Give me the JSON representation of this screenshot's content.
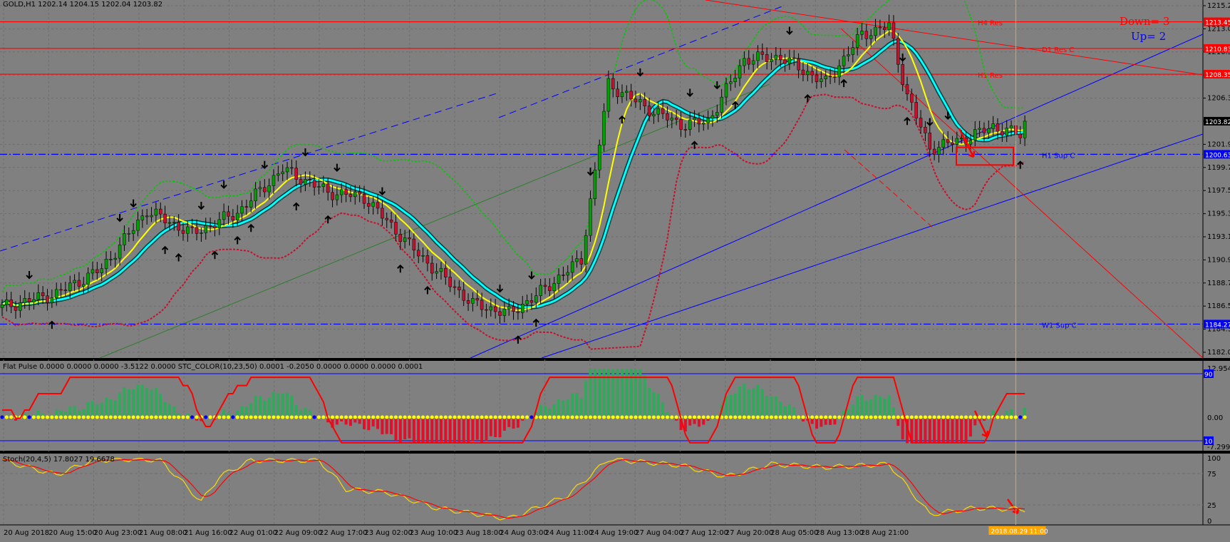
{
  "window": {
    "symbol_header": "GOLD,H1  1202.14 1204.15 1202.04 1203.82"
  },
  "signals": {
    "down": "Down=  3",
    "up": "Up=  2"
  },
  "colors": {
    "background": "#808080",
    "grid": "#6e6e6e",
    "bull": "#00a000",
    "bear": "#c8102e",
    "yellow_ma": "#ffff00",
    "cyan_ma": "#00ffff",
    "upper_band": "#00c800",
    "lower_band": "#c8102e",
    "resistance": "#ff0000",
    "support": "#0000ff",
    "cursor": "#ffa500",
    "stoch_main": "#ff0000",
    "stoch_signal": "#ffd700"
  },
  "chart_data": [
    {
      "type": "candlestick",
      "title": "GOLD,H1",
      "ylim": [
        1181.0,
        1215.5
      ],
      "y_ticks": [
        "1215.25",
        "1213.00",
        "1210.55",
        "1208.10",
        "1206.35",
        "1203.90",
        "1201.95",
        "1199.75",
        "1197.50",
        "1195.30",
        "1193.10",
        "1190.90",
        "1188.70",
        "1186.50",
        "1184.30",
        "1182.05"
      ],
      "x_ticks": [
        "20 Aug 2018",
        "20 Aug 15:00",
        "20 Aug 23:00",
        "21 Aug 08:00",
        "21 Aug 16:00",
        "22 Aug 01:00",
        "22 Aug 09:00",
        "22 Aug 17:00",
        "23 Aug 02:00",
        "23 Aug 10:00",
        "23 Aug 18:00",
        "24 Aug 03:00",
        "24 Aug 11:00",
        "24 Aug 19:00",
        "27 Aug 04:00",
        "27 Aug 12:00",
        "27 Aug 20:00",
        "28 Aug 05:00",
        "28 Aug 13:00",
        "28 Aug 21:00"
      ],
      "cursor_time_label": "2018.08.29 11:00",
      "price_waypoints": [
        [
          0,
          1185.9
        ],
        [
          12,
          1187.2
        ],
        [
          22,
          1189.6
        ],
        [
          32,
          1195.2
        ],
        [
          42,
          1193.0
        ],
        [
          52,
          1195.0
        ],
        [
          62,
          1199.2
        ],
        [
          72,
          1197.0
        ],
        [
          80,
          1196.5
        ],
        [
          92,
          1191.0
        ],
        [
          104,
          1186.2
        ],
        [
          112,
          1185.3
        ],
        [
          118,
          1187.0
        ],
        [
          128,
          1190.5
        ],
        [
          134,
          1207.4
        ],
        [
          142,
          1205.2
        ],
        [
          150,
          1203.5
        ],
        [
          156,
          1203.8
        ],
        [
          164,
          1209.8
        ],
        [
          172,
          1210.0
        ],
        [
          182,
          1207.5
        ],
        [
          190,
          1212.2
        ],
        [
          196,
          1213.0
        ],
        [
          200,
          1206.3
        ],
        [
          205,
          1201.2
        ],
        [
          212,
          1202.0
        ],
        [
          219,
          1203.3
        ],
        [
          225,
          1202.5
        ],
        [
          226,
          1203.82
        ]
      ],
      "horizontal_levels": [
        {
          "price": 1213.4,
          "label": "H4 Res",
          "price_label": "1213.45",
          "color": "#ff0000",
          "style": "solid"
        },
        {
          "price": 1210.83,
          "label": "D1 Res C",
          "price_label": "1210.83",
          "color": "#ff0000",
          "style": "solid"
        },
        {
          "price": 1208.35,
          "label": "H1 Res",
          "price_label": "1208.35",
          "color": "#ff0000",
          "style": "solid"
        },
        {
          "price": 1200.63,
          "label": "H1 Sup C",
          "price_label": "1200.63",
          "color": "#0000ff",
          "style": "dashdot"
        },
        {
          "price": 1184.27,
          "label": "W1 Sup C",
          "price_label": "1184.27",
          "color": "#0000ff",
          "style": "dashdot"
        }
      ],
      "current_price_label": "1203.82",
      "target_box": {
        "price_top": 1201.3,
        "price_bottom": 1199.6
      },
      "arrows_down_bars": [
        6,
        26,
        29,
        44,
        49,
        58,
        67,
        74,
        84,
        110,
        117,
        130,
        141,
        152,
        158,
        174,
        199,
        205,
        209
      ],
      "arrows_up_bars": [
        11,
        36,
        39,
        47,
        52,
        55,
        65,
        72,
        88,
        94,
        114,
        118,
        137,
        153,
        162,
        178,
        186,
        200,
        225
      ]
    },
    {
      "type": "histogram",
      "title": "Flat Pulse 0.0000 0.0000 0.0000 -3.5122 0.0000 STC_COLOR(10,23,50) 0.0001 -0.2050 0.0000 0.0000 0.0000 0.0001",
      "ylim": [
        -7.2997,
        12.9543
      ],
      "y_ticks": [
        "12.9543",
        "90",
        "0.00",
        "10",
        "-7.2997"
      ]
    },
    {
      "type": "line",
      "title": "Stoch(20,4,5) 17.8027 19.6678",
      "ylim": [
        0,
        100
      ],
      "y_ticks": [
        "100",
        "75",
        "25",
        "0"
      ],
      "stoch_waypoints": [
        [
          0,
          96
        ],
        [
          12,
          73
        ],
        [
          20,
          96
        ],
        [
          30,
          98
        ],
        [
          35,
          96
        ],
        [
          40,
          60
        ],
        [
          44,
          30
        ],
        [
          48,
          70
        ],
        [
          55,
          96
        ],
        [
          60,
          96
        ],
        [
          70,
          96
        ],
        [
          76,
          50
        ],
        [
          85,
          45
        ],
        [
          96,
          20
        ],
        [
          112,
          3
        ],
        [
          125,
          40
        ],
        [
          134,
          98
        ],
        [
          150,
          88
        ],
        [
          160,
          70
        ],
        [
          170,
          90
        ],
        [
          182,
          85
        ],
        [
          196,
          90
        ],
        [
          205,
          10
        ],
        [
          215,
          20
        ],
        [
          226,
          18
        ]
      ]
    }
  ]
}
